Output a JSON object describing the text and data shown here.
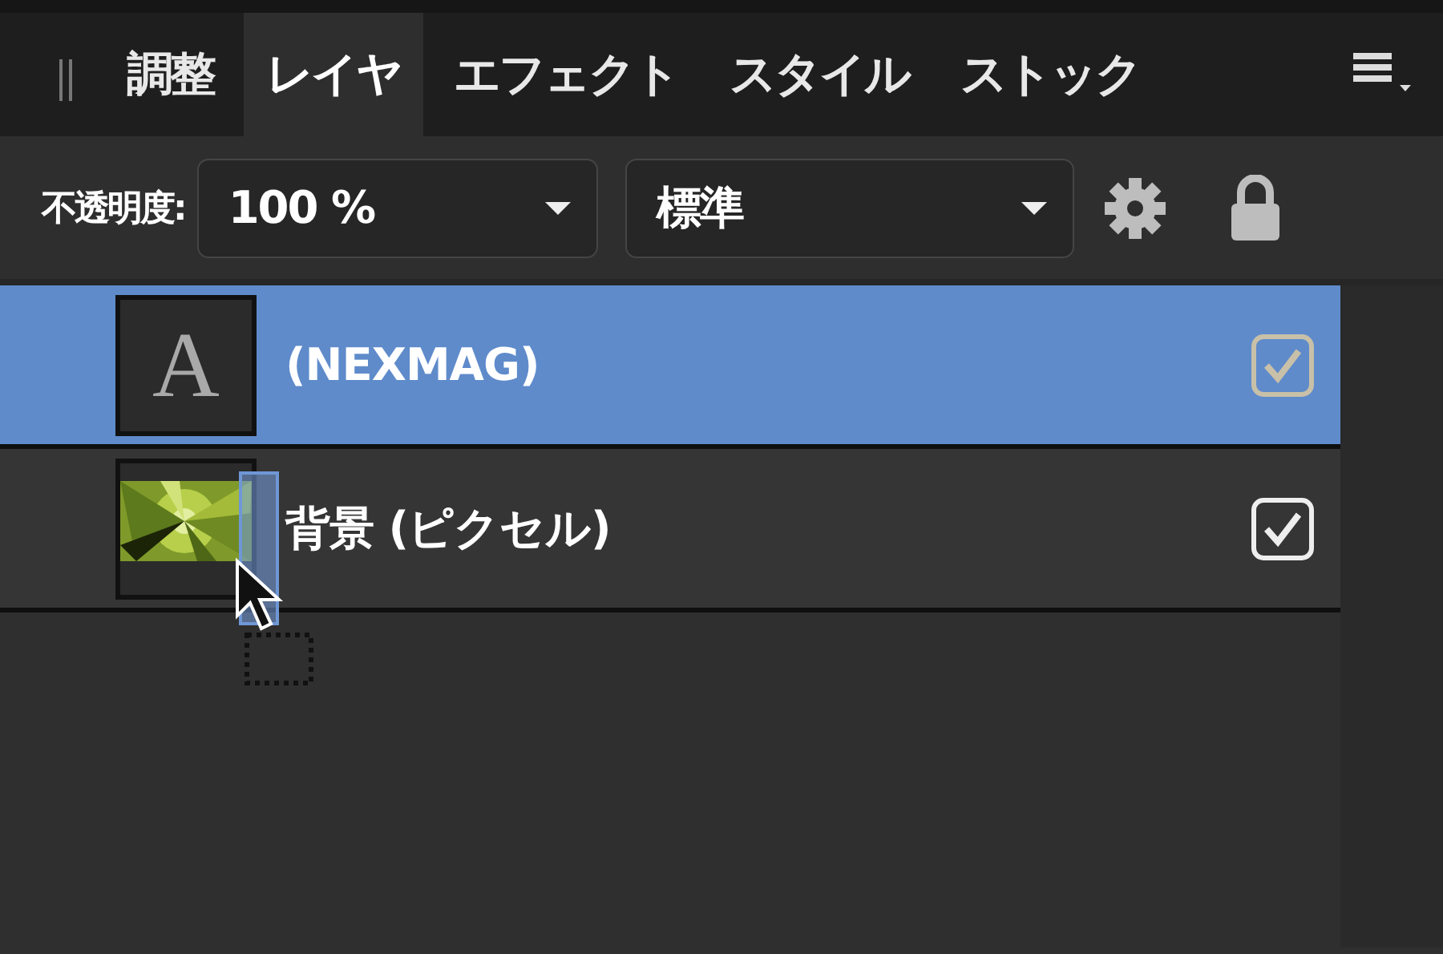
{
  "tabs": [
    {
      "label": "調整",
      "selected": false
    },
    {
      "label": "レイヤ",
      "selected": true
    },
    {
      "label": "エフェクト",
      "selected": false
    },
    {
      "label": "スタイル",
      "selected": false
    },
    {
      "label": "ストック",
      "selected": false
    }
  ],
  "toolbar": {
    "opacity_label": "不透明度:",
    "opacity": "100 %",
    "blend_mode": "標準"
  },
  "layers": [
    {
      "kind": "text",
      "thumbnail_glyph": "A",
      "name": "(NEXMAG)",
      "selected": true,
      "visible": true
    },
    {
      "kind": "pixel",
      "name": "背景 (ピクセル)",
      "selected": false,
      "visible": true
    }
  ]
}
